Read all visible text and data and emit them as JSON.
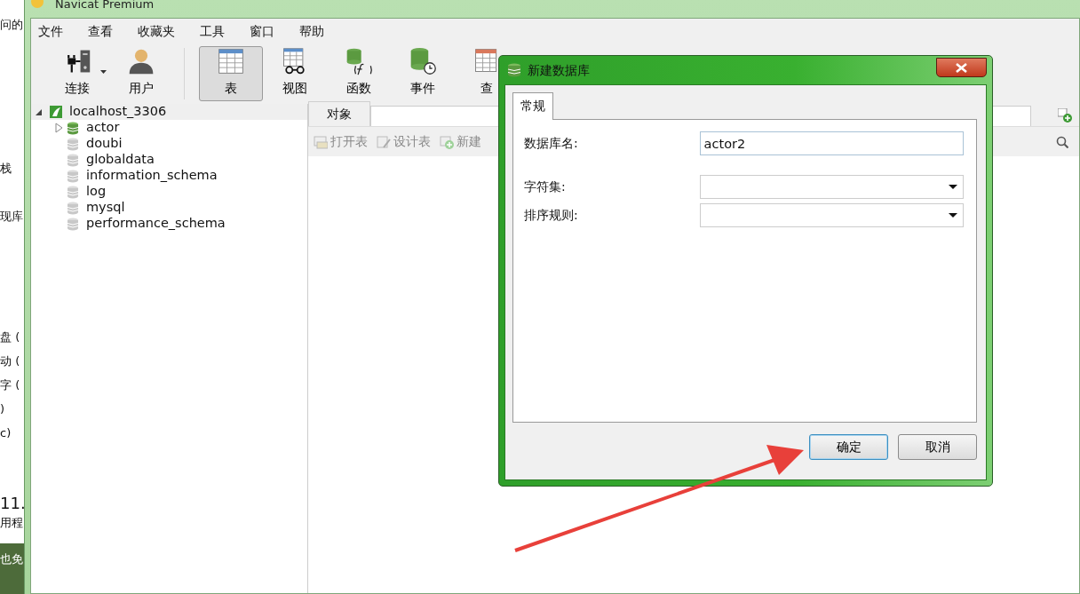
{
  "desktop_fragments": [
    "问的",
    "栈",
    "现库",
    "盘 (",
    "动 (",
    "字 (",
    ")",
    "c)",
    "11.",
    "用程",
    "也免"
  ],
  "window": {
    "title": "Navicat Premium"
  },
  "menu": [
    "文件",
    "查看",
    "收藏夹",
    "工具",
    "窗口",
    "帮助"
  ],
  "toolbar": [
    {
      "label": "连接",
      "selected": false,
      "dropdown": true
    },
    {
      "label": "用户",
      "selected": false,
      "dropdown": false
    },
    {
      "label": "表",
      "selected": true,
      "dropdown": false
    },
    {
      "label": "视图",
      "selected": false,
      "dropdown": false
    },
    {
      "label": "函数",
      "selected": false,
      "dropdown": false
    },
    {
      "label": "事件",
      "selected": false,
      "dropdown": false
    },
    {
      "label": "查",
      "selected": false,
      "dropdown": false
    }
  ],
  "tree": {
    "label": "localhost_3306",
    "expanded": true,
    "selected": true,
    "children": [
      {
        "label": "actor",
        "open": true,
        "expandable": true,
        "selected": false
      },
      {
        "label": "doubi",
        "open": false,
        "expandable": false,
        "selected": false
      },
      {
        "label": "globaldata",
        "open": false,
        "expandable": false,
        "selected": false
      },
      {
        "label": "information_schema",
        "open": false,
        "expandable": false,
        "selected": false
      },
      {
        "label": "log",
        "open": false,
        "expandable": false,
        "selected": false
      },
      {
        "label": "mysql",
        "open": false,
        "expandable": false,
        "selected": false
      },
      {
        "label": "performance_schema",
        "open": false,
        "expandable": false,
        "selected": false
      }
    ]
  },
  "object_tabs": [
    {
      "label": "对象",
      "selected": true
    }
  ],
  "object_toolbar": [
    "打开表",
    "设计表",
    "新建"
  ],
  "dialog": {
    "title": "新建数据库",
    "tabs": [
      {
        "label": "常规",
        "selected": true
      }
    ],
    "fields": [
      {
        "label": "数据库名:",
        "kind": "text",
        "value": "actor2"
      },
      {
        "label": "字符集:",
        "kind": "select"
      },
      {
        "label": "排序规则:",
        "kind": "select"
      }
    ],
    "buttons": [
      {
        "label": "确定",
        "focused": true
      },
      {
        "label": "取消",
        "focused": false
      }
    ]
  }
}
